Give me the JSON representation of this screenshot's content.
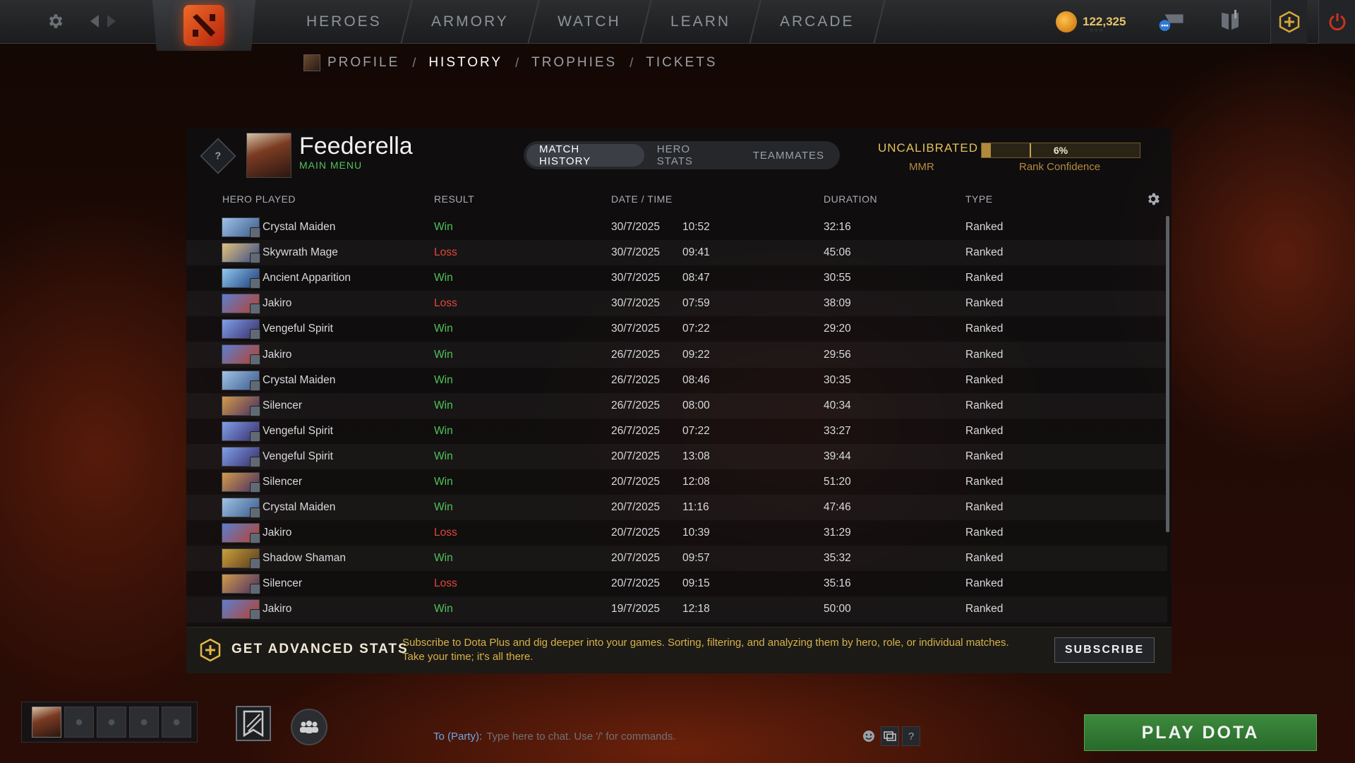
{
  "colors": {
    "win": "#4fc35a",
    "loss": "#e0473c",
    "gold_accent": "#e3c15c",
    "play_green": "#2f7a31"
  },
  "topbar": {
    "nav": [
      "HEROES",
      "ARMORY",
      "WATCH",
      "LEARN",
      "ARCADE"
    ],
    "currency_amount": "122,325",
    "icons": [
      "gear-icon",
      "back-arrow-icon",
      "forward-arrow-icon",
      "dota-logo-icon",
      "shards-icon",
      "chat-bubble-icon",
      "compendium-icon",
      "dota-plus-icon",
      "power-icon"
    ]
  },
  "breadcrumb": {
    "items": [
      "PROFILE",
      "HISTORY",
      "TROPHIES",
      "TICKETS"
    ],
    "active": "HISTORY"
  },
  "profile": {
    "rank_badge": "?",
    "name": "Feederella",
    "subtitle": "MAIN MENU",
    "tabs": [
      "MATCH HISTORY",
      "HERO STATS",
      "TEAMMATES"
    ],
    "active_tab": "MATCH HISTORY",
    "uncalibrated": "UNCALIBRATED",
    "mmr_label": "MMR",
    "rank_confidence_value": 0.06,
    "rank_confidence_text": "6%",
    "rank_confidence_label": "Rank Confidence"
  },
  "table": {
    "columns": [
      "HERO PLAYED",
      "RESULT",
      "DATE / TIME",
      "DURATION",
      "TYPE"
    ],
    "rows": [
      {
        "hero": "Crystal Maiden",
        "result": "Win",
        "date": "30/7/2025",
        "time": "10:52",
        "duration": "32:16",
        "type": "Ranked"
      },
      {
        "hero": "Skywrath Mage",
        "result": "Loss",
        "date": "30/7/2025",
        "time": "09:41",
        "duration": "45:06",
        "type": "Ranked"
      },
      {
        "hero": "Ancient Apparition",
        "result": "Win",
        "date": "30/7/2025",
        "time": "08:47",
        "duration": "30:55",
        "type": "Ranked"
      },
      {
        "hero": "Jakiro",
        "result": "Loss",
        "date": "30/7/2025",
        "time": "07:59",
        "duration": "38:09",
        "type": "Ranked"
      },
      {
        "hero": "Vengeful Spirit",
        "result": "Win",
        "date": "30/7/2025",
        "time": "07:22",
        "duration": "29:20",
        "type": "Ranked"
      },
      {
        "hero": "Jakiro",
        "result": "Win",
        "date": "26/7/2025",
        "time": "09:22",
        "duration": "29:56",
        "type": "Ranked"
      },
      {
        "hero": "Crystal Maiden",
        "result": "Win",
        "date": "26/7/2025",
        "time": "08:46",
        "duration": "30:35",
        "type": "Ranked"
      },
      {
        "hero": "Silencer",
        "result": "Win",
        "date": "26/7/2025",
        "time": "08:00",
        "duration": "40:34",
        "type": "Ranked"
      },
      {
        "hero": "Vengeful Spirit",
        "result": "Win",
        "date": "26/7/2025",
        "time": "07:22",
        "duration": "33:27",
        "type": "Ranked"
      },
      {
        "hero": "Vengeful Spirit",
        "result": "Win",
        "date": "20/7/2025",
        "time": "13:08",
        "duration": "39:44",
        "type": "Ranked"
      },
      {
        "hero": "Silencer",
        "result": "Win",
        "date": "20/7/2025",
        "time": "12:08",
        "duration": "51:20",
        "type": "Ranked"
      },
      {
        "hero": "Crystal Maiden",
        "result": "Win",
        "date": "20/7/2025",
        "time": "11:16",
        "duration": "47:46",
        "type": "Ranked"
      },
      {
        "hero": "Jakiro",
        "result": "Loss",
        "date": "20/7/2025",
        "time": "10:39",
        "duration": "31:29",
        "type": "Ranked"
      },
      {
        "hero": "Shadow Shaman",
        "result": "Win",
        "date": "20/7/2025",
        "time": "09:57",
        "duration": "35:32",
        "type": "Ranked"
      },
      {
        "hero": "Silencer",
        "result": "Loss",
        "date": "20/7/2025",
        "time": "09:15",
        "duration": "35:16",
        "type": "Ranked"
      },
      {
        "hero": "Jakiro",
        "result": "Win",
        "date": "19/7/2025",
        "time": "12:18",
        "duration": "50:00",
        "type": "Ranked"
      }
    ]
  },
  "promo": {
    "title": "GET ADVANCED STATS",
    "text": "Subscribe to Dota Plus and dig deeper into your games. Sorting, filtering, and analyzing them by hero, role, or individual matches. Take your time; it's all there.",
    "button": "SUBSCRIBE"
  },
  "bottom": {
    "chat_target": "To (Party):",
    "chat_placeholder": "Type here to chat. Use '/' for commands.",
    "help_label": "?",
    "play_label": "PLAY DOTA"
  }
}
